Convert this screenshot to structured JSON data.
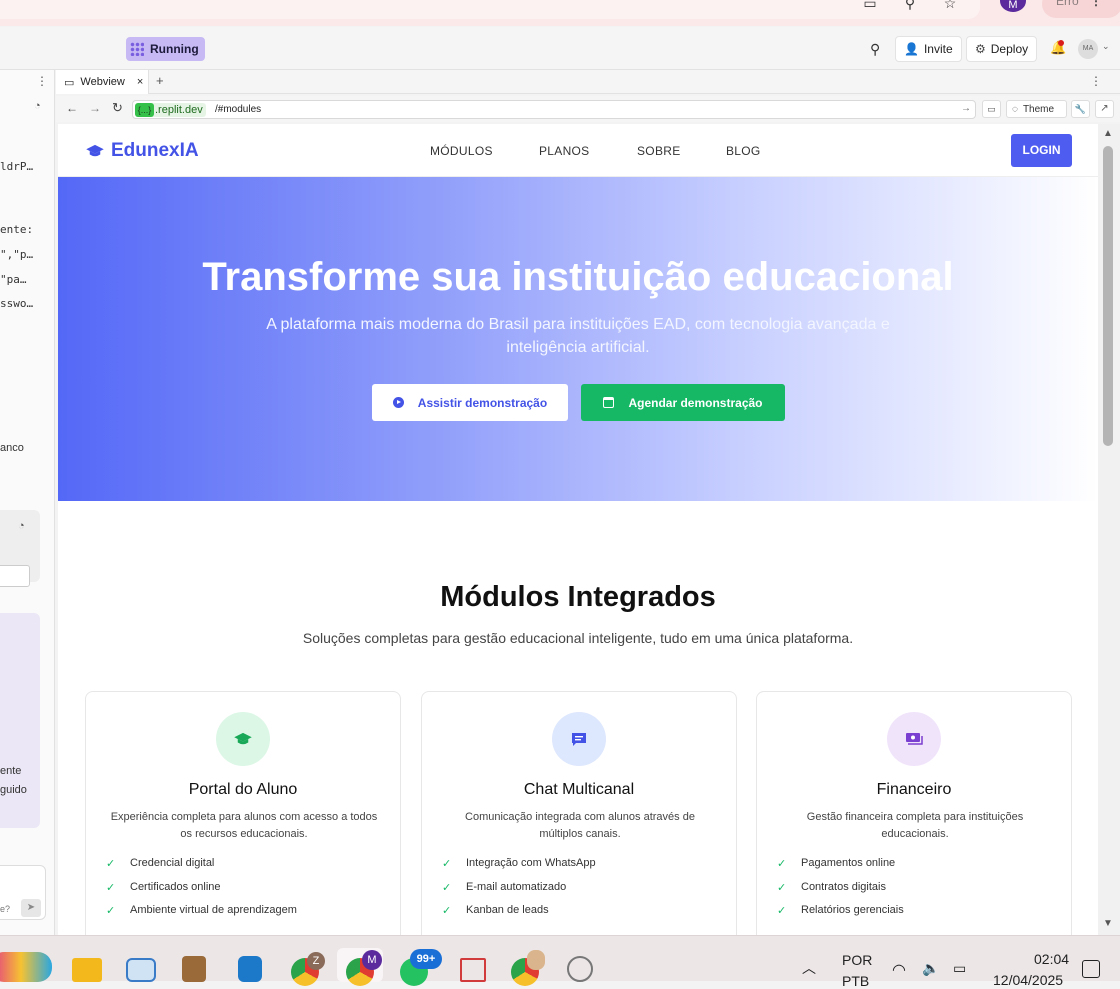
{
  "replit": {
    "running_label": "Running",
    "invite_label": "Invite",
    "deploy_label": "Deploy",
    "avatar_initials": "MA"
  },
  "left_panel": {
    "code_lines": [
      "ldrP…",
      "ente:",
      "\",\"p…",
      "\"pa…",
      "sswo…"
    ],
    "snippet_1": "anco",
    "snippet_2": "ente",
    "snippet_3": "guido",
    "snippet_4": "e?"
  },
  "tabs": {
    "webview_label": "Webview",
    "close": "×",
    "add": "+"
  },
  "url": {
    "domain": ".replit.dev",
    "path": "/#modules",
    "theme_label": "Theme"
  },
  "site": {
    "logo": "EdunexIA",
    "nav": [
      "MÓDULOS",
      "PLANOS",
      "SOBRE",
      "BLOG"
    ],
    "login": "LOGIN",
    "hero": {
      "title": "Transforme sua instituição educacional",
      "subtitle": "A plataforma mais moderna do Brasil para instituições EAD, com tecnologia avançada e inteligência artificial.",
      "watch_button": "Assistir demonstração",
      "schedule_button": "Agendar demonstração"
    },
    "modules": {
      "title": "Módulos Integrados",
      "subtitle": "Soluções completas para gestão educacional inteligente, tudo em uma única plataforma.",
      "cards": [
        {
          "title": "Portal do Aluno",
          "desc": "Experiência completa para alunos com acesso a todos os recursos educacionais.",
          "features": [
            "Credencial digital",
            "Certificados online",
            "Ambiente virtual de aprendizagem"
          ],
          "icon": "graduation-cap-icon",
          "circle_color": "#dcf7e6",
          "icon_color": "#18a857"
        },
        {
          "title": "Chat Multicanal",
          "desc": "Comunicação integrada com alunos através de múltiplos canais.",
          "features": [
            "Integração com WhatsApp",
            "E-mail automatizado",
            "Kanban de leads"
          ],
          "icon": "chat-bubble-icon",
          "circle_color": "#dde7fd",
          "icon_color": "#4353e6"
        },
        {
          "title": "Financeiro",
          "desc": "Gestão financeira completa para instituições educacionais.",
          "features": [
            "Pagamentos online",
            "Contratos digitais",
            "Relatórios gerenciais"
          ],
          "icon": "money-icon",
          "circle_color": "#f0e4fb",
          "icon_color": "#7a3fd0"
        }
      ]
    }
  },
  "taskbar": {
    "lang_1": "POR",
    "lang_2": "PTB",
    "time": "02:04",
    "date": "12/04/2025",
    "badge_m": "M",
    "badge_z": "Z",
    "badge_99": "99+"
  },
  "chrome": {
    "profile_initial": "M",
    "error_label": "Erro"
  }
}
